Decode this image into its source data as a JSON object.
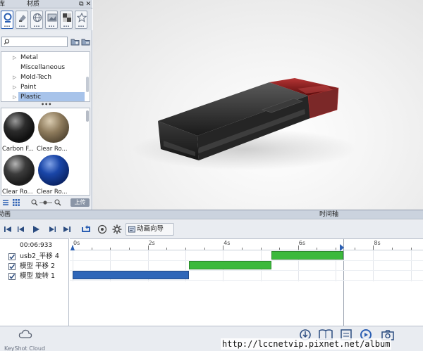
{
  "library_panel": {
    "tab_library": "库",
    "tab_materials": "材质",
    "panel_controls": "⧉ ✕",
    "category_icons": [
      "materials-icon",
      "paint-icon",
      "environment-icon",
      "backplate-icon",
      "texture-icon",
      "favorites-icon"
    ],
    "category_dots": "...",
    "search": {
      "placeholder": "",
      "value": ""
    },
    "tree_items": [
      {
        "label": "Metal",
        "expandable": true
      },
      {
        "label": "Miscellaneous",
        "expandable": false
      },
      {
        "label": "Mold-Tech",
        "expandable": true
      },
      {
        "label": "Paint",
        "expandable": true
      },
      {
        "label": "Plastic",
        "expandable": true,
        "selected": true
      }
    ],
    "splitter_dots": "•••",
    "thumbnails": [
      {
        "label": "Carbon F...",
        "color": "#1c1c1c"
      },
      {
        "label": "Clear Ro...",
        "color": "#7d6a4d"
      },
      {
        "label": "Clear Ro...",
        "color": "#2e2e2e"
      },
      {
        "label": "Clear Ro...",
        "color": "#0d2e7a"
      }
    ],
    "upload_label": "上传"
  },
  "animation": {
    "panel_title": "动画",
    "timeline_title": "时间轴",
    "wizard_label": "动画向导",
    "time_readout": "00:06:933",
    "ruler_labels": [
      "0s",
      "2s",
      "4s",
      "6s",
      "8s"
    ],
    "tracks": [
      {
        "name": "usb2_平移 4",
        "checked": true,
        "start_s": 5.3,
        "end_s": 7.2,
        "color": "#3cb93c"
      },
      {
        "name": "模型 平移 2",
        "checked": true,
        "start_s": 3.1,
        "end_s": 5.3,
        "color": "#3cb93c"
      },
      {
        "name": "模型 旋转 1",
        "checked": true,
        "start_s": 0.0,
        "end_s": 3.1,
        "color": "#2f66b8"
      }
    ],
    "playhead_s": 7.2
  },
  "bottom": {
    "keyshot_cloud_label": "KeyShot Cloud"
  },
  "watermark": "http://lccnetvip.pixnet.net/album",
  "colors": {
    "accent": "#2b5fb3",
    "selected_row": "#a7c3ea",
    "usb_body": "#2a2a2a",
    "usb_cap": "#8a1010"
  }
}
